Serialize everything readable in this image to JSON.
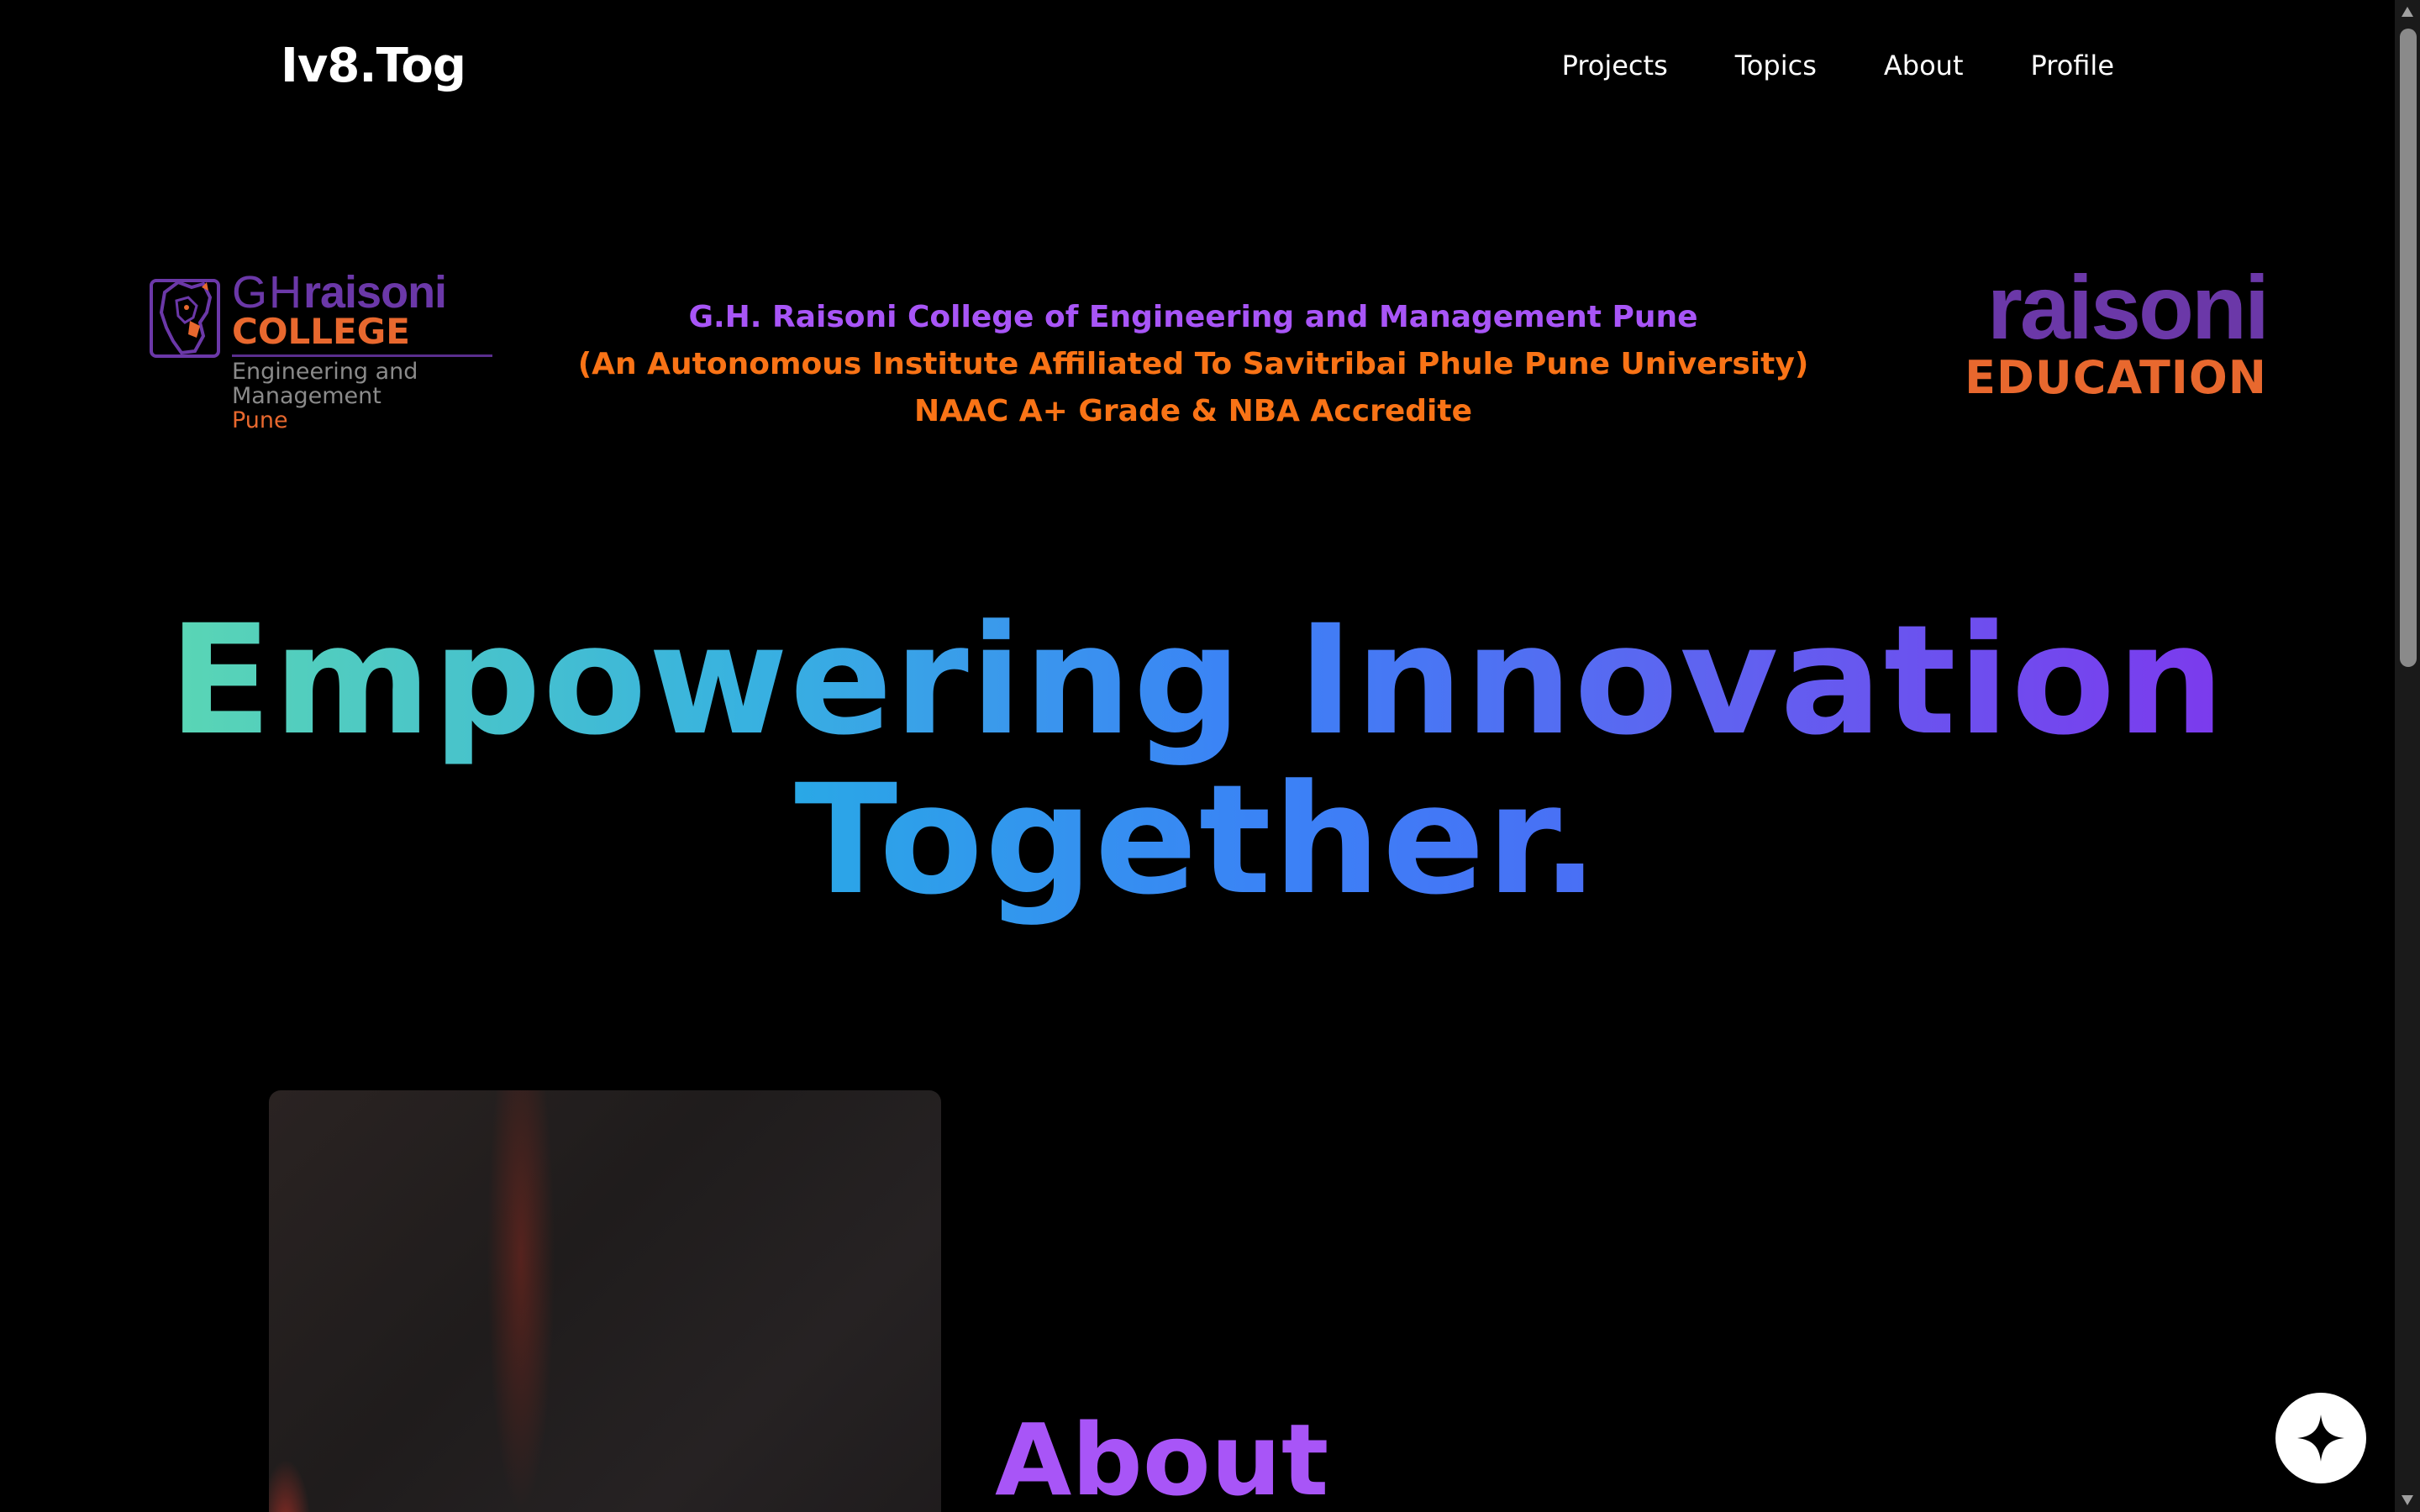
{
  "nav": {
    "brand": "Iv8.Tog",
    "links": [
      "Projects",
      "Topics",
      "About",
      "Profile"
    ]
  },
  "college_logo": {
    "gh": "GH",
    "raisoni": "raisoni",
    "college": "COLLEGE",
    "sub1": "Engineering and",
    "sub2": "Management",
    "sub3": "Pune"
  },
  "college_info": {
    "line1": "G.H. Raisoni College of Engineering and Management Pune",
    "line2": "(An Autonomous Institute Affiliated To Savitribai Phule Pune University)",
    "line3": "NAAC A+ Grade & NBA Accredite"
  },
  "edu_logo": {
    "raisoni": "raisoni",
    "education": "EDUCATION"
  },
  "hero": {
    "line1": "Empowering Innovation",
    "line2": "Together."
  },
  "about": {
    "title": "About"
  },
  "colors": {
    "background": "#000000",
    "purple": "#a855f7",
    "orange": "#f97316",
    "logo_purple": "#6b38a8",
    "logo_orange": "#e8682e"
  },
  "icons": {
    "fab": "sparkle-icon"
  }
}
